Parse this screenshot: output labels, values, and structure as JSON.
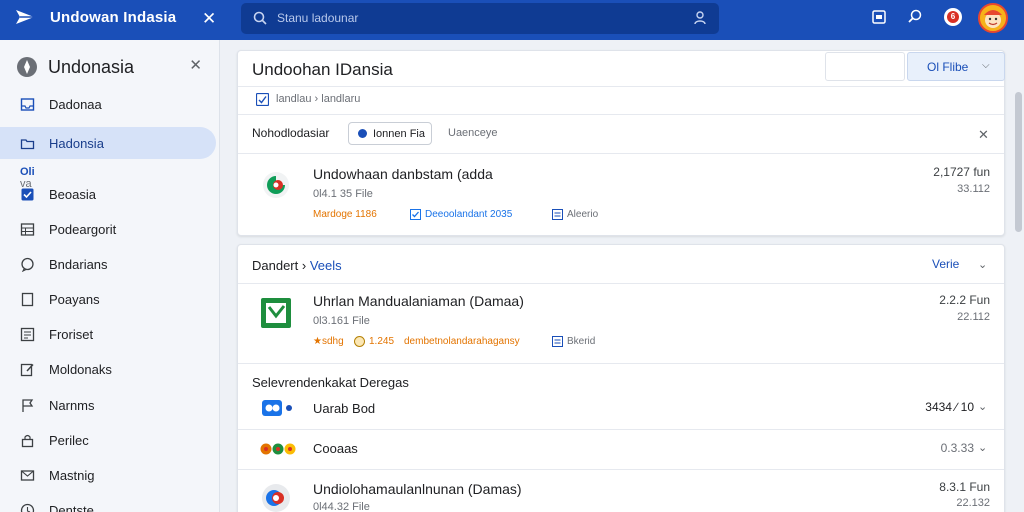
{
  "topbar": {
    "app_title": "Undowan Indasia",
    "search_placeholder": "Stanu ladounar"
  },
  "sidebar": {
    "title": "Undonasia",
    "section_label": "Oli",
    "section_sub": "va",
    "items": [
      {
        "label": "Dadonaa",
        "icon": "inbox-icon"
      },
      {
        "label": "Hadonsia",
        "icon": "folder-icon"
      },
      {
        "label": "Beoasia",
        "icon": "checkbox-icon"
      },
      {
        "label": "Podeargorit",
        "icon": "table-icon"
      },
      {
        "label": "Bndarians",
        "icon": "chat-icon"
      },
      {
        "label": "Poayans",
        "icon": "document-icon"
      },
      {
        "label": "Froriset",
        "icon": "list-icon"
      },
      {
        "label": "Moldonaks",
        "icon": "edit-icon"
      },
      {
        "label": "Narnms",
        "icon": "flag-icon"
      },
      {
        "label": "Perilec",
        "icon": "lock-icon"
      },
      {
        "label": "Mastnig",
        "icon": "mail-icon"
      },
      {
        "label": "Dentste",
        "icon": "clock-icon"
      }
    ]
  },
  "main": {
    "page_title": "Undoohan IDansia",
    "input_value": "",
    "file_button": "Ol Flibe",
    "breadcrumb": "landlau › landlaru",
    "filter_label": "Nohodlodasiar",
    "filter_chip": "Ionnen Fia",
    "filter_secondary": "Uaenceye",
    "result1": {
      "title": "Undowhaan danbstam (adda",
      "sub": "0l4.1 35 File",
      "tag1": "Mardoge 1186",
      "tag2": "Deeoolandant 2035",
      "tag3": "Aleerio",
      "num1": "2,1727 fun",
      "num2": "33.112"
    },
    "section2": {
      "title": "Dandert ›",
      "title_link": "Veels",
      "verify": "Verie",
      "result": {
        "title": "Uhrlan Mandualaniaman (Damaa)",
        "sub": "0l3.161 File",
        "tag1": "★sdhg",
        "tag2": "1.245",
        "tag3": "dembetnolandarahagansy",
        "tag4": "Bkerid",
        "num1": "2.2.2 Fun",
        "num2": "22.112"
      },
      "subheading": "Selevrendenkakat Deregas",
      "rows": [
        {
          "label": "Uarab Bod",
          "value": "3434 ∕ 10"
        },
        {
          "label": "Cooaas",
          "value": "0.3.33"
        },
        {
          "label": "Undiolohamaulanlnunan (Damas)",
          "value": "8.3.1 Fun",
          "sub": "0l44.32 File",
          "sub_value": "22.132"
        }
      ]
    }
  },
  "colors": {
    "primary": "#1a4fb8",
    "active_bg": "#d6e2f8",
    "orange": "#e37400",
    "link": "#1a73e8"
  }
}
